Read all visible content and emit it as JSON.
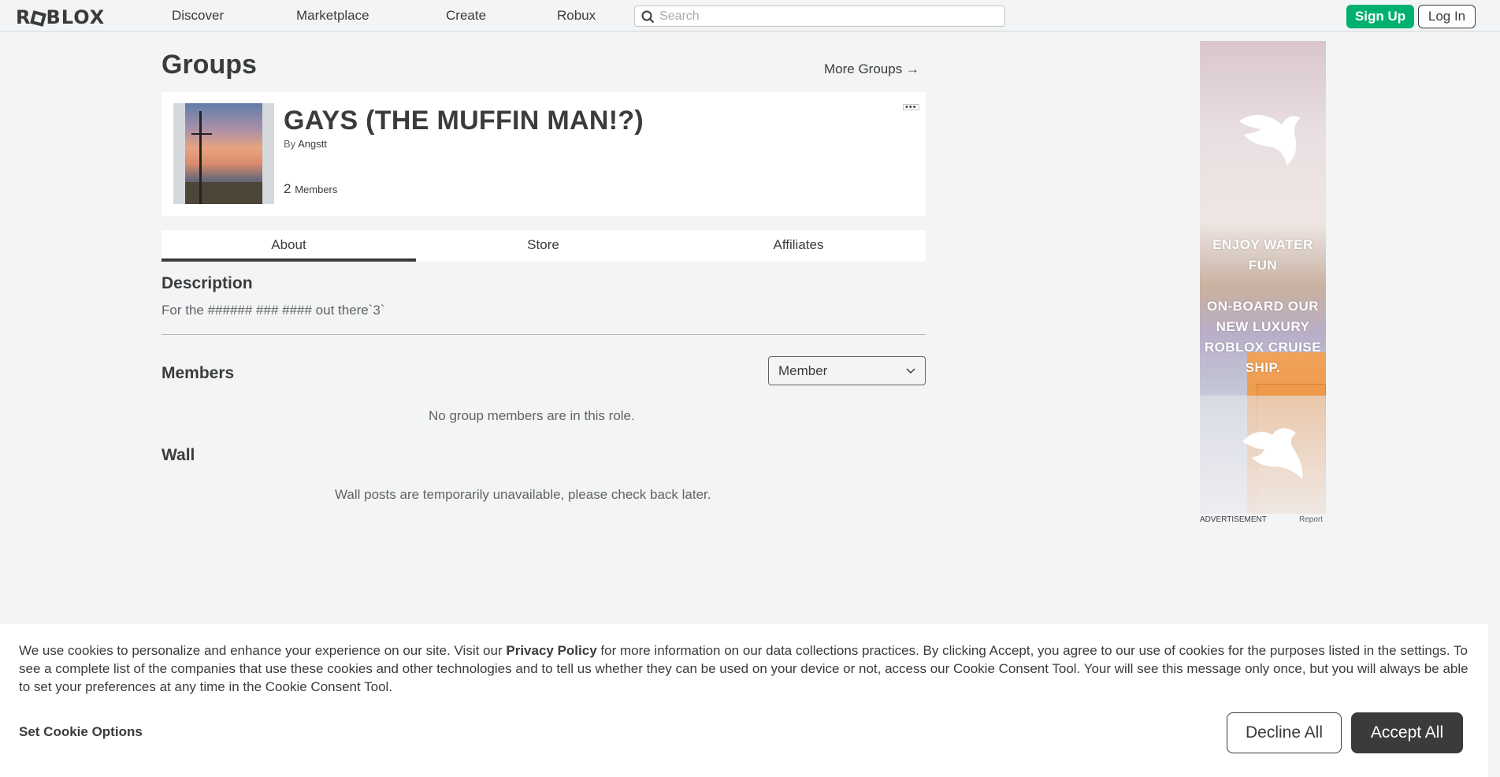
{
  "nav": {
    "logo": "ROBLOX",
    "links": [
      "Discover",
      "Marketplace",
      "Create",
      "Robux"
    ],
    "search_placeholder": "Search",
    "signup_label": "Sign Up",
    "login_label": "Log In"
  },
  "page": {
    "title": "Groups",
    "more_groups": "More Groups →"
  },
  "group": {
    "name": "GAYS (THE MUFFIN MAN!?)",
    "by_label": "By",
    "owner": "Angstt",
    "member_count": "2",
    "members_label": "Members",
    "more_icon": "more-options-icon"
  },
  "tabs": [
    "About",
    "Store",
    "Affiliates"
  ],
  "about": {
    "description_heading": "Description",
    "description_text": "For the ###### ### #### out there`3`",
    "members_heading": "Members",
    "role_selected": "Member",
    "members_empty": "No group members are in this role.",
    "wall_heading": "Wall",
    "wall_message": "Wall posts are temporarily unavailable, please check back later."
  },
  "ad": {
    "line1": "ENJOY WATER FUN",
    "line2": "ON-BOARD OUR NEW LUXURY ROBLOX CRUISE SHIP.",
    "label": "ADVERTISEMENT",
    "report": "Report"
  },
  "cookie": {
    "text_before": "We use cookies to personalize and enhance your experience on our site. Visit our ",
    "privacy_link": "Privacy Policy",
    "text_after": " for more information on our data collections practices. By clicking Accept, you agree to our use of cookies for the purposes listed in the settings. To see a complete list of the companies that use these cookies and other technologies and to tell us whether they can be used on your device or not, access our Cookie Consent Tool. Your will see this message only once, but you will always be able to set your preferences at any time in the Cookie Consent Tool.",
    "options_label": "Set Cookie Options",
    "decline_label": "Decline All",
    "accept_label": "Accept All"
  },
  "colors": {
    "accent_green": "#00b06f",
    "text_primary": "#393b3d",
    "background": "#f2f4f5"
  }
}
